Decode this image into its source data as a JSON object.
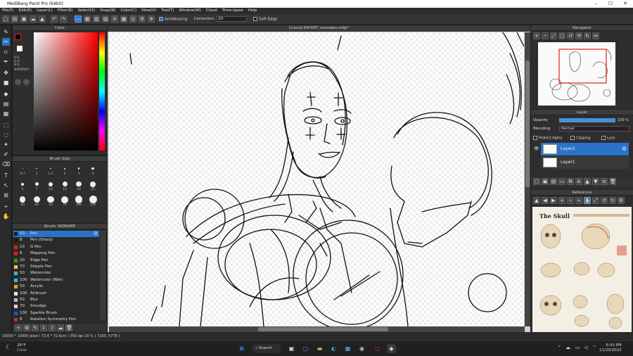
{
  "window": {
    "title": "MediBang Paint Pro (64bit)",
    "minimize": "–",
    "maximize": "☐",
    "close": "✕"
  },
  "menu": [
    "File(F)",
    "Edit(E)",
    "Layer(L)",
    "Filter(R)",
    "Select(S)",
    "Snap(N)",
    "Color(C)",
    "View(V)",
    "Tool(T)",
    "Window(W)",
    "Cloud",
    "Time-lapse",
    "Help"
  ],
  "toolbar": {
    "antialiasing_label": "AntiAliasing",
    "correction_label": "Correction",
    "correction_value": "20",
    "soft_edge_label": "Soft Edge"
  },
  "color_panel": {
    "title": "Color",
    "r": "R:0",
    "g": "G:0",
    "b": "B:0",
    "hex": "#000000"
  },
  "brush_size": {
    "title": "Brush Size",
    "sizes": [
      "0.7",
      "1",
      "1.5",
      "2",
      "3",
      "4",
      "5",
      "7",
      "10",
      "15",
      "20",
      "25",
      "30",
      "40",
      "50",
      "70",
      "100",
      "150"
    ]
  },
  "brush_list": {
    "title": "Brush: NONAME",
    "items": [
      {
        "size": "50",
        "name": "Pen",
        "color": "#1a1a1a"
      },
      {
        "size": "8",
        "name": "Pen (Sharp)",
        "color": "#1a1a1a"
      },
      {
        "size": "10",
        "name": "G Pen",
        "color": "#e02020"
      },
      {
        "size": "8",
        "name": "Mapping Pen",
        "color": "#e02020"
      },
      {
        "size": "20",
        "name": "Edge Pen",
        "color": "#20a030"
      },
      {
        "size": "70",
        "name": "Stipple Pen",
        "color": "#f0d020"
      },
      {
        "size": "50",
        "name": "Watercolor",
        "color": "#30b8e8"
      },
      {
        "size": "100",
        "name": "Watercolor (Wet)",
        "color": "#30b8e8"
      },
      {
        "size": "50",
        "name": "Acrylic",
        "color": "#f0a020"
      },
      {
        "size": "100",
        "name": "Airbrush",
        "color": "#e8e8e8"
      },
      {
        "size": "50",
        "name": "Blur",
        "color": "#90c8f0"
      },
      {
        "size": "70",
        "name": "Smudge",
        "color": "#f0d0d0"
      },
      {
        "size": "100",
        "name": "Sparkle Brush",
        "color": "#2050e0"
      },
      {
        "size": "8",
        "name": "Rotation Symmetry Pen",
        "color": "#e02020"
      }
    ]
  },
  "canvas": {
    "tab_title": "[cloud] KH/OST concepts.mdp*"
  },
  "navigator": {
    "title": "Navigator"
  },
  "layer_panel": {
    "title": "Layer",
    "opacity_label": "Opacity",
    "opacity_value": "100 %",
    "opacity_fraction": 1.0,
    "blending_label": "Blending",
    "blending_value": "Normal",
    "protect_alpha": "Protect Alpha",
    "clipping": "Clipping",
    "lock": "Lock",
    "layers": [
      {
        "name": "Layer2",
        "selected": true
      },
      {
        "name": "Layer1",
        "selected": false
      }
    ]
  },
  "reference": {
    "title": "Reference",
    "poster_title": "The Skull"
  },
  "status": {
    "text": "10000 * 10000 pixel  ( 72.6 * 72.6cm )  350 dpi  16 %  ( 7160, 5778 )"
  },
  "taskbar": {
    "weather_temp": "26°F",
    "weather_desc": "Clear",
    "search_label": "Search",
    "time": "6:43 PM",
    "date": "11/20/2022"
  }
}
